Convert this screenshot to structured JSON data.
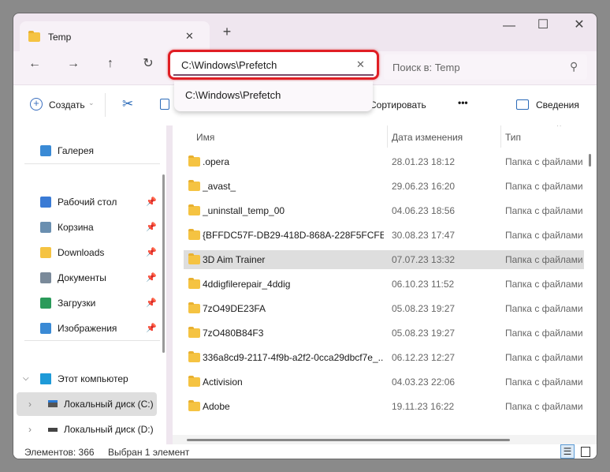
{
  "window": {
    "tab_title": "Temp",
    "new_tab": "+",
    "minimize": "—",
    "maximize": "☐",
    "close": "✕"
  },
  "nav": {
    "back": "←",
    "forward": "→",
    "up": "↑",
    "refresh": "↻",
    "address_value": "C:\\Windows\\Prefetch",
    "clear": "✕",
    "search_placeholder": "Поиск в: Temp",
    "search_icon": "⚲"
  },
  "autocomplete": {
    "items": [
      "C:\\Windows\\Prefetch"
    ]
  },
  "toolbar": {
    "create": "Создать",
    "sort": "Сортировать",
    "more": "•••",
    "details": "Сведения"
  },
  "sidebar": {
    "gallery": "Галерея",
    "quick": [
      {
        "label": "Рабочий стол",
        "icon": "desktop-icon",
        "color": "#3a7bd5"
      },
      {
        "label": "Корзина",
        "icon": "recycle-bin-icon",
        "color": "#6a8fb0"
      },
      {
        "label": "Downloads",
        "icon": "folder-icon",
        "color": "#f5c342"
      },
      {
        "label": "Документы",
        "icon": "documents-icon",
        "color": "#7a8a9a"
      },
      {
        "label": "Загрузки",
        "icon": "download-icon",
        "color": "#2a9a5a"
      },
      {
        "label": "Изображения",
        "icon": "pictures-icon",
        "color": "#3a8ad5"
      }
    ],
    "this_pc": "Этот компьютер",
    "drives": [
      "Локальный диск (C:)",
      "Локальный диск (D:)"
    ]
  },
  "columns": {
    "name": "Имя",
    "date": "Дата изменения",
    "type": "Тип"
  },
  "files": [
    {
      "name": ".opera",
      "date": "28.01.23 18:12",
      "type": "Папка с файлами"
    },
    {
      "name": "_avast_",
      "date": "29.06.23 16:20",
      "type": "Папка с файлами"
    },
    {
      "name": "_uninstall_temp_00",
      "date": "04.06.23 18:56",
      "type": "Папка с файлами"
    },
    {
      "name": "{BFFDC57F-DB29-418D-868A-228F5FCFE...",
      "date": "30.08.23 17:47",
      "type": "Папка с файлами"
    },
    {
      "name": "3D Aim Trainer",
      "date": "07.07.23 13:32",
      "type": "Папка с файлами",
      "selected": true
    },
    {
      "name": "4ddigfilerepair_4ddig",
      "date": "06.10.23 11:52",
      "type": "Папка с файлами"
    },
    {
      "name": "7zO49DE23FA",
      "date": "05.08.23 19:27",
      "type": "Папка с файлами"
    },
    {
      "name": "7zO480B84F3",
      "date": "05.08.23 19:27",
      "type": "Папка с файлами"
    },
    {
      "name": "336a8cd9-2117-4f9b-a2f2-0cca29dbcf7e_...",
      "date": "06.12.23 12:27",
      "type": "Папка с файлами"
    },
    {
      "name": "Activision",
      "date": "04.03.23 22:06",
      "type": "Папка с файлами"
    },
    {
      "name": "Adobe",
      "date": "19.11.23 16:22",
      "type": "Папка с файлами"
    }
  ],
  "status": {
    "count": "Элементов: 366",
    "selected": "Выбран 1 элемент"
  },
  "colors": {
    "highlight": "#e01e24",
    "titlebar": "#efe6ef"
  }
}
